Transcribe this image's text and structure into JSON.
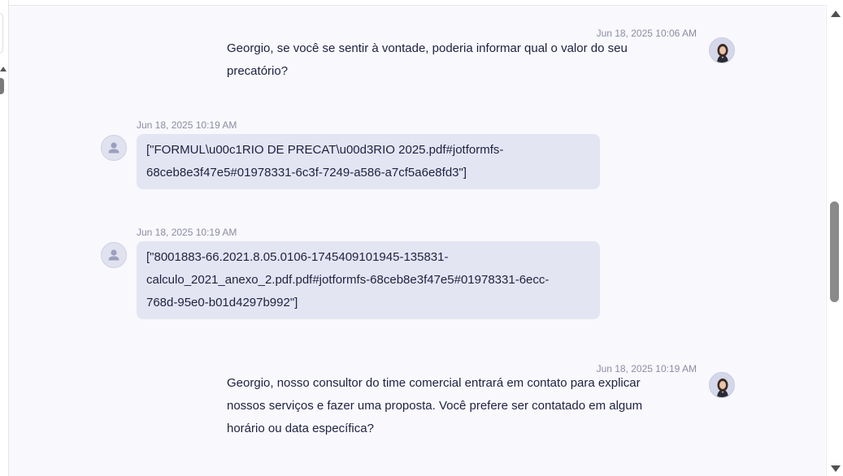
{
  "messages": [
    {
      "sender": "agent",
      "timestamp": "Jun 18, 2025 10:06 AM",
      "lines": [
        "Georgio, se você se sentir à vontade, poderia informar qual o valor do seu",
        "precatório?"
      ]
    },
    {
      "sender": "user",
      "timestamp": "Jun 18, 2025 10:19 AM",
      "lines": [
        "[\"FORMUL\\u00c1RIO DE PRECAT\\u00d3RIO 2025.pdf#jotformfs-",
        "68ceb8e3f47e5#01978331-6c3f-7249-a586-a7cf5a6e8fd3\"]"
      ]
    },
    {
      "sender": "user",
      "timestamp": "Jun 18, 2025 10:19 AM",
      "lines": [
        "[\"8001883-66.2021.8.05.0106-1745409101945-135831-",
        "calculo_2021_anexo_2.pdf.pdf#jotformfs-68ceb8e3f47e5#01978331-6ecc-",
        "768d-95e0-b01d4297b992\"]"
      ]
    },
    {
      "sender": "agent",
      "timestamp": "Jun 18, 2025 10:19 AM",
      "lines": [
        "Georgio, nosso consultor do time comercial entrará em contato para explicar",
        "nossos serviços e fazer uma proposta. Você prefere ser contatado em algum",
        "horário ou data específica?"
      ]
    }
  ],
  "icons": {
    "agent_avatar": "agent-avatar-icon",
    "user_avatar": "user-avatar-icon",
    "scroll_up": "scroll-up-arrow-icon",
    "scroll_down": "scroll-down-arrow-icon"
  },
  "colors": {
    "chat_background": "#f8f8fd",
    "user_bubble": "#e4e5f3",
    "text": "#1f2140",
    "timestamp": "#8b8ca3"
  }
}
